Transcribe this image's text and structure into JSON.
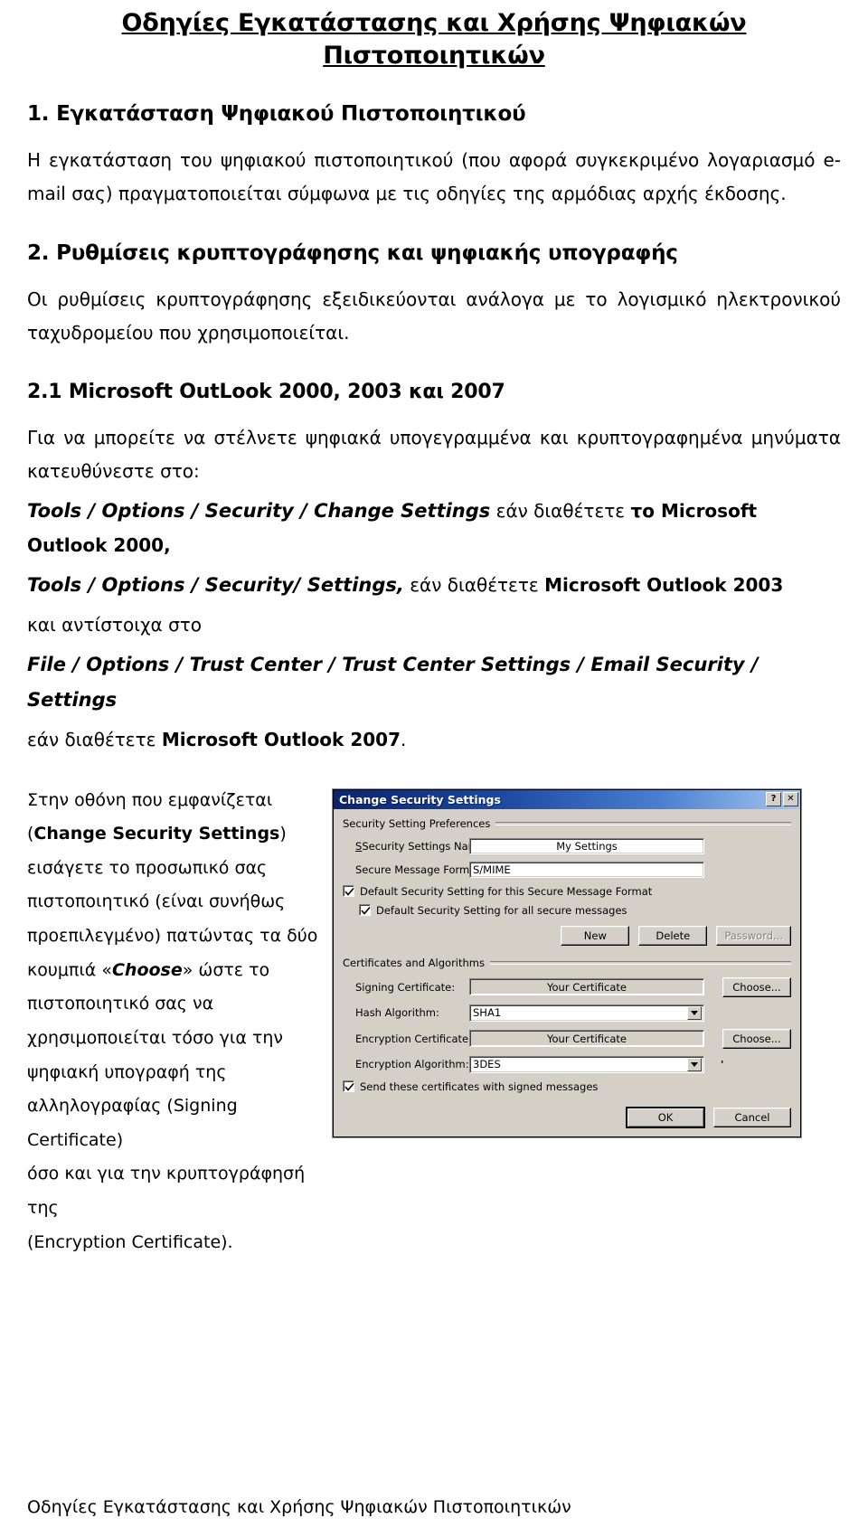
{
  "document": {
    "title_line1": "Οδηγίες Εγκατάστασης  και Χρήσης Ψηφιακών",
    "title_line2": "Πιστοποιητικών",
    "footer": "Οδηγίες Εγκατάστασης  και Χρήσης Ψηφιακών Πιστοποιητικών"
  },
  "sections": {
    "s1_heading": "1. Εγκατάσταση Ψηφιακού Πιστοποιητικού",
    "s1_body": "Η εγκατάσταση του ψηφιακού πιστοποιητικού (που αφορά συγκεκριμένο λογαριασμό e-mail σας) πραγματοποιείται σύμφωνα με τις οδηγίες της αρμόδιας αρχής έκδοσης.",
    "s2_heading": "2. Ρυθμίσεις κρυπτογράφησης και ψηφιακής υπογραφής",
    "s2_body": "Οι ρυθμίσεις κρυπτογράφησης εξειδικεύονται ανάλογα με το λογισμικό ηλεκτρονικού ταχυδρομείου που χρησιμοποιείται.",
    "s21_heading": "2.1 Microsoft OutLook 2000, 2003 και 2007",
    "s21_body": "Για να μπορείτε να στέλνετε ψηφιακά υπογεγραμμένα και κρυπτογραφημένα μηνύματα κατευθύνεστε στο:",
    "path1_cmd": "Tools / Options / Security / Change Settings",
    "path1_mid": " εάν διαθέτετε ",
    "path1_strong": "το Microsoft Outlook 2000,",
    "path2_cmd": "Tools / Options / Security/ Settings,",
    "path2_mid": " εάν διαθέτετε ",
    "path2_strong": "Microsoft Outlook 2003",
    "path2_tail": "και αντίστοιχα στο",
    "path3_cmd": "File / Options / Trust Center / Trust Center Settings / Email Security / Settings",
    "path3_mid": "εάν διαθέτετε ",
    "path3_strong": "Microsoft Outlook 2007",
    "path3_tail": "."
  },
  "left_column": {
    "l1": "Στην οθόνη που εμφανίζεται",
    "l2_open": "(",
    "l2_bold": "Change Security Settings",
    "l2_close": ")",
    "l3": "εισάγετε το προσωπικό σας",
    "l4": "πιστοποιητικό (είναι συνήθως",
    "l5": "προεπιλεγμένο) πατώντας τα δύο",
    "l6_pre": "κουμπιά «",
    "l6_bold": "Choose",
    "l6_post": "» ώστε το",
    "l7": "πιστοποιητικό σας να",
    "l8": "χρησιμοποιείται τόσο για την",
    "l9": "ψηφιακή υπογραφή της",
    "l10": "αλληλογραφίας (Signing Certificate)",
    "l11": "όσο και για την κρυπτογράφησή της",
    "l12": "(Encryption Certificate)."
  },
  "dialog": {
    "title": "Change Security Settings",
    "help_button": "?",
    "close_button": "✕",
    "group1_label": "Security Setting Preferences",
    "settings_name_label": "Security Settings Name:",
    "settings_name_value": "My Settings",
    "message_format_label": "Secure Message Format:",
    "message_format_value": "S/MIME",
    "checkbox1_label": "Default Security Setting for this Secure Message Format",
    "checkbox2_label": "Default Security Setting for all secure messages",
    "new_button": "New",
    "delete_button": "Delete",
    "password_button": "Password...",
    "group2_label": "Certificates and Algorithms",
    "signing_cert_label": "Signing Certificate:",
    "signing_cert_value": "Your Certificate",
    "signing_choose_button": "Choose...",
    "hash_label": "Hash Algorithm:",
    "hash_value": "SHA1",
    "encryption_cert_label": "Encryption Certificate:",
    "encryption_cert_value": "Your Certificate",
    "encryption_choose_button": "Choose...",
    "encryption_algo_label": "Encryption Algorithm:",
    "encryption_algo_value": "3DES",
    "send_certs_label": "Send these certificates with signed messages",
    "ok_button": "OK",
    "cancel_button": "Cancel"
  }
}
